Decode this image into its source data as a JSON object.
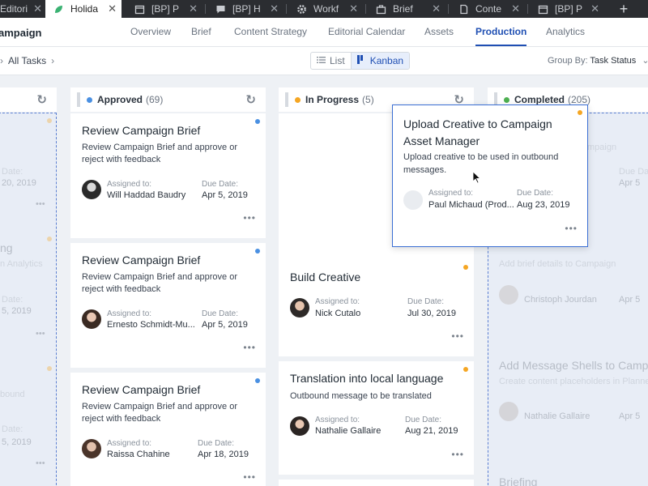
{
  "browser": {
    "tabs": [
      {
        "label": "Editori",
        "icon": "page-icon"
      },
      {
        "label": "Holida",
        "icon": "leaf-icon",
        "active": true
      },
      {
        "label": "[BP] P",
        "icon": "calendar-icon"
      },
      {
        "label": "[BP] H",
        "icon": "chat-icon"
      },
      {
        "label": "Workf",
        "icon": "gear-icon"
      },
      {
        "label": "Brief",
        "icon": "briefcase-icon"
      },
      {
        "label": "Conte",
        "icon": "document-icon"
      },
      {
        "label": "[BP] P",
        "icon": "calendar-icon"
      }
    ],
    "new_tab": "+"
  },
  "app": {
    "campaign_title": "ampaign",
    "nav": [
      "Overview",
      "Brief",
      "Content Strategy",
      "Editorial Calendar",
      "Assets",
      "Production",
      "Analytics"
    ],
    "active_nav": "Production"
  },
  "toolbar": {
    "breadcrumb": "All Tasks",
    "view_list": "List",
    "view_kanban": "Kanban",
    "group_by_label": "Group By:",
    "group_by_value": "Task Status"
  },
  "colors": {
    "approved": "#4a90e2",
    "in_progress": "#f5a623",
    "completed": "#4caf50",
    "accent": "#1f4fb3"
  },
  "columns": {
    "approved": {
      "name": "Approved",
      "count": "(69)",
      "cards": [
        {
          "title": "Review Campaign Brief",
          "desc1": "Review Campaign Brief and approve or",
          "desc2": "reject with feedback",
          "assigned_label": "Assigned to:",
          "assignee": "Will Haddad Baudry",
          "due_label": "Due Date:",
          "due": "Apr 5, 2019"
        },
        {
          "title": "Review Campaign Brief",
          "desc1": "Review Campaign Brief and approve or",
          "desc2": "reject with feedback",
          "assigned_label": "Assigned to:",
          "assignee": "Ernesto Schmidt-Mu...",
          "due_label": "Due Date:",
          "due": "Apr 5, 2019"
        },
        {
          "title": "Review Campaign Brief",
          "desc1": "Review Campaign Brief and approve or",
          "desc2": "reject with feedback",
          "assigned_label": "Assigned to:",
          "assignee": "Raissa Chahine",
          "due_label": "Due Date:",
          "due": "Apr 18, 2019"
        }
      ]
    },
    "in_progress": {
      "name": "In Progress",
      "count": "(5)",
      "cards": [
        {
          "title": "Build Creative",
          "assigned_label": "Assigned to:",
          "assignee": "Nick Cutalo",
          "due_label": "Due Date:",
          "due": "Jul 30, 2019"
        },
        {
          "title": "Translation into local language",
          "desc1": "Outbound message to be translated",
          "assigned_label": "Assigned to:",
          "assignee": "Nathalie Gallaire",
          "due_label": "Due Date:",
          "due": "Aug 21, 2019"
        }
      ]
    },
    "completed": {
      "name": "Completed",
      "count": "(205)",
      "ghost": [
        {
          "sub": "mpaign",
          "due": "Due Da",
          "date": "Apr 5"
        },
        {
          "sub": "Add brief details to Campaign",
          "assignee": "Christoph Jourdan",
          "due": "Apr 5"
        },
        {
          "title": "Add Message Shells to Camp",
          "sub": "Create content placeholders in Planne",
          "assignee": "Nathalie Gallaire",
          "due": "Apr 5"
        },
        {
          "title": "Briefing"
        }
      ]
    },
    "left_ghost": [
      {
        "due": "Date:",
        "date": "20, 2019"
      },
      {
        "title": "ng",
        "sub": "n Analytics",
        "due": "Date:",
        "date": "5, 2019"
      },
      {
        "sub": "bound",
        "due": "Date:",
        "date": "5, 2019"
      }
    ]
  },
  "drag_card": {
    "title1": "Upload Creative to Campaign",
    "title2": "Asset Manager",
    "desc1": "Upload creative to be used in outbound",
    "desc2": "messages.",
    "assigned_label": "Assigned to:",
    "assignee": "Paul Michaud (Prod...",
    "due_label": "Due Date:",
    "due": "Aug 23, 2019"
  },
  "more_label": "•••"
}
